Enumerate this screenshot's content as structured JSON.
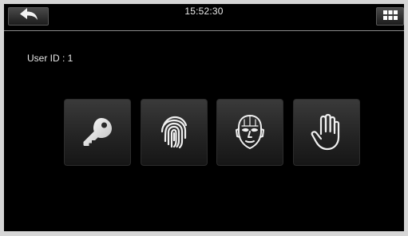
{
  "header": {
    "time": "15:52:30",
    "back_icon": "back-arrow-icon",
    "menu_icon": "grid-menu-icon"
  },
  "user": {
    "id_label": "User ID : 1"
  },
  "verify_methods": [
    {
      "icon": "key-icon",
      "method": "password"
    },
    {
      "icon": "fingerprint-icon",
      "method": "fingerprint"
    },
    {
      "icon": "face-icon",
      "method": "face"
    },
    {
      "icon": "palm-icon",
      "method": "palm"
    }
  ],
  "colors": {
    "screen_background": "#000000",
    "text": "#e6e6e6",
    "tile_top": "#3a3a3a",
    "tile_bottom": "#161616",
    "icon": "#f0f0f0"
  }
}
